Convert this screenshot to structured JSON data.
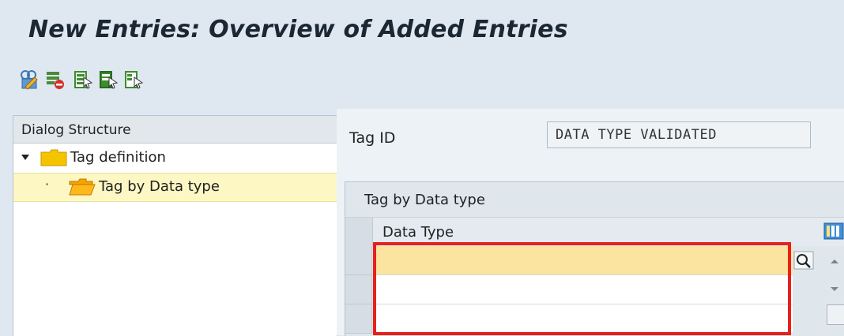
{
  "header": {
    "title": "New Entries: Overview of Added Entries"
  },
  "toolbar": {
    "buttons": [
      {
        "name": "display-change-icon"
      },
      {
        "name": "delete-row-icon"
      },
      {
        "name": "select-all-icon"
      },
      {
        "name": "select-block-icon"
      },
      {
        "name": "deselect-all-icon"
      }
    ]
  },
  "dialog_structure": {
    "title": "Dialog Structure",
    "items": [
      {
        "label": "Tag definition",
        "level": 0,
        "expanded": true
      },
      {
        "label": "Tag by Data type",
        "level": 1,
        "selected": true
      }
    ]
  },
  "detail": {
    "tag_id_label": "Tag ID",
    "tag_id_value": "DATA TYPE VALIDATED"
  },
  "table": {
    "title": "Tag by Data type",
    "columns": [
      "Data Type"
    ],
    "rows": [
      {
        "data_type": ""
      },
      {
        "data_type": ""
      },
      {
        "data_type": ""
      }
    ]
  },
  "colors": {
    "highlight": "#e8201a",
    "active_row": "#fbe4a0",
    "selected_tree": "#fdf7c4",
    "folder": "#f5c400"
  }
}
